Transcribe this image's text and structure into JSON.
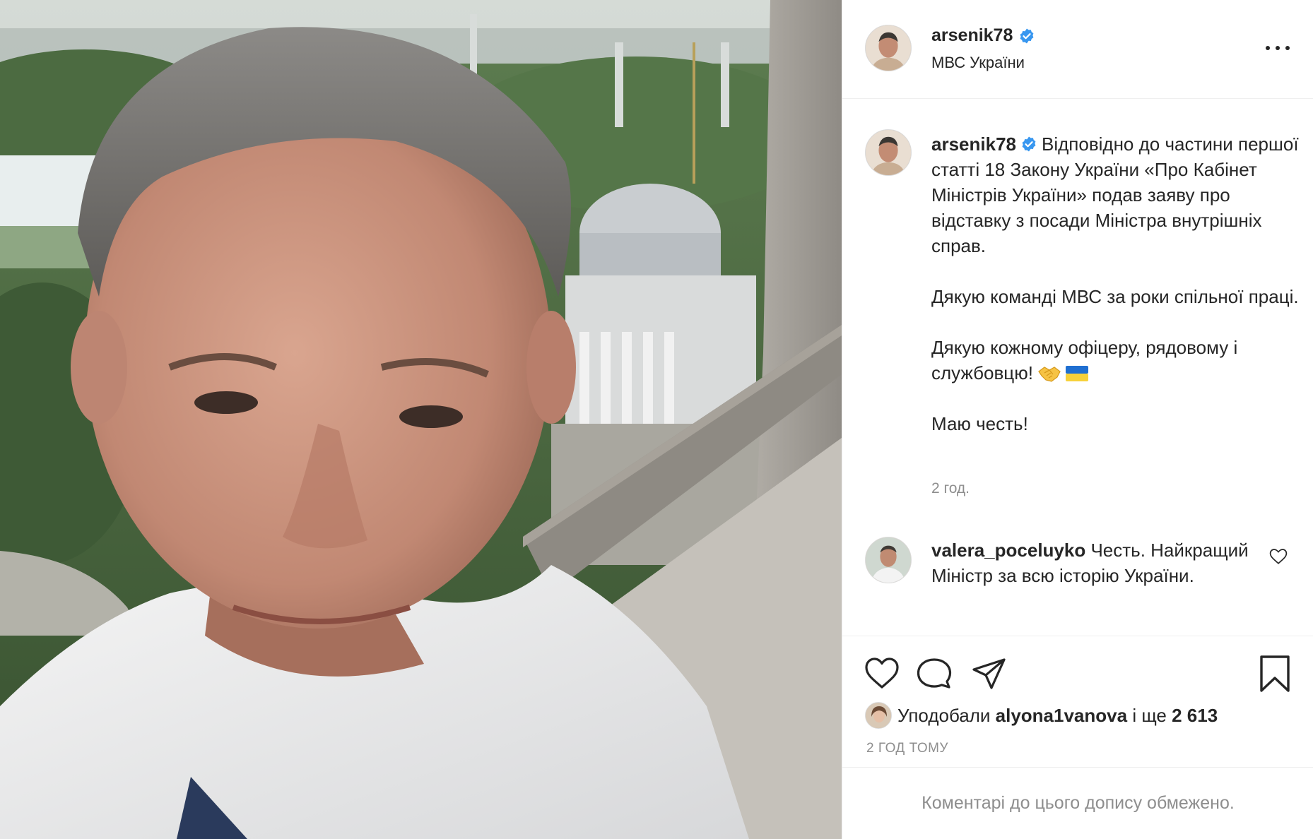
{
  "header": {
    "username": "arsenik78",
    "location": "МВС України",
    "verified_icon": "verified-badge-icon",
    "more_icon": "more-options-icon"
  },
  "caption": {
    "username": "arsenik78",
    "paragraph1": "Відповідно до частини першої статті 18 Закону України «Про Кабінет Міністрів України» подав заяву про відставку з посади Міністра внутрішніх справ.",
    "paragraph2": "Дякую команді МВС за роки спільної праці.",
    "paragraph3": "Дякую кожному офіцеру, рядовому і службовцю!",
    "paragraph3_emojis": [
      "handshake-emoji",
      "ukraine-flag-emoji"
    ],
    "paragraph4": "Маю честь!",
    "time": "2 год."
  },
  "comment": {
    "username": "valera_poceluyko",
    "text": "Честь. Найкращий Міністр за всю історію України."
  },
  "actions": {
    "icons": [
      "heart-icon",
      "comment-icon",
      "share-icon",
      "bookmark-icon"
    ]
  },
  "likes": {
    "prefix": "Уподобали",
    "user": "alyona1vanova",
    "middle": "і ще",
    "count": "2 613"
  },
  "post_time": "2 ГОД ТОМУ",
  "footer": {
    "text": "Коментарі до цього допису обмежено."
  },
  "colors": {
    "verified": "#3897f0",
    "text": "#262626",
    "secondary": "#8e8e8e",
    "divider": "#efefef"
  }
}
